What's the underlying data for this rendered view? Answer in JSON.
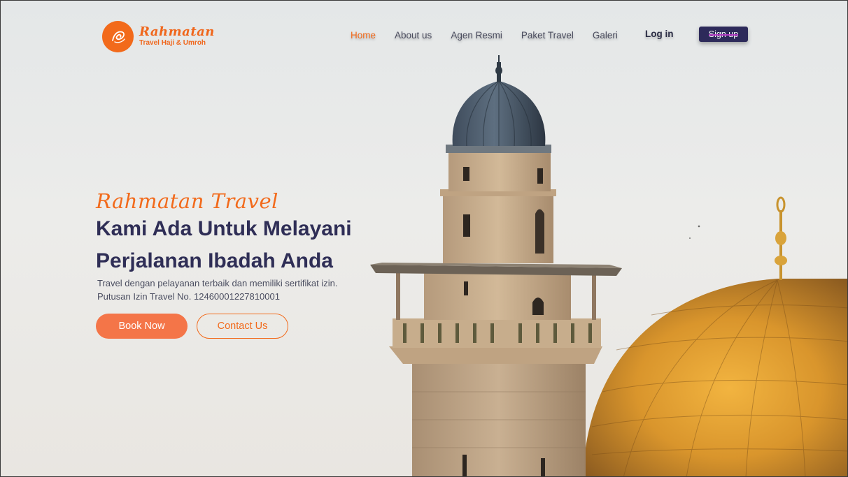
{
  "brand": {
    "name": "Rahmatan",
    "tagline": "Travel Haji & Umroh",
    "accent": "#f26a1b",
    "navy": "#2f2e56"
  },
  "nav": {
    "items": [
      "Home",
      "About us",
      "Agen Resmi",
      "Paket Travel",
      "Galeri"
    ],
    "active": "Home",
    "login_label": "Log in",
    "signup_label": "Sign up"
  },
  "hero": {
    "script_title": "Rahmatan Travel",
    "headline": "Kami Ada Untuk Melayani Perjalanan Ibadah Anda",
    "desc_line1": "Travel dengan pelayanan terbaik dan memiliki sertifikat izin.",
    "desc_line2": "Putusan Izin Travel  No. 12460001227810001",
    "book_label": "Book Now",
    "contact_label": "Contact Us",
    "image": "mosque-minaret-and-golden-dome"
  }
}
